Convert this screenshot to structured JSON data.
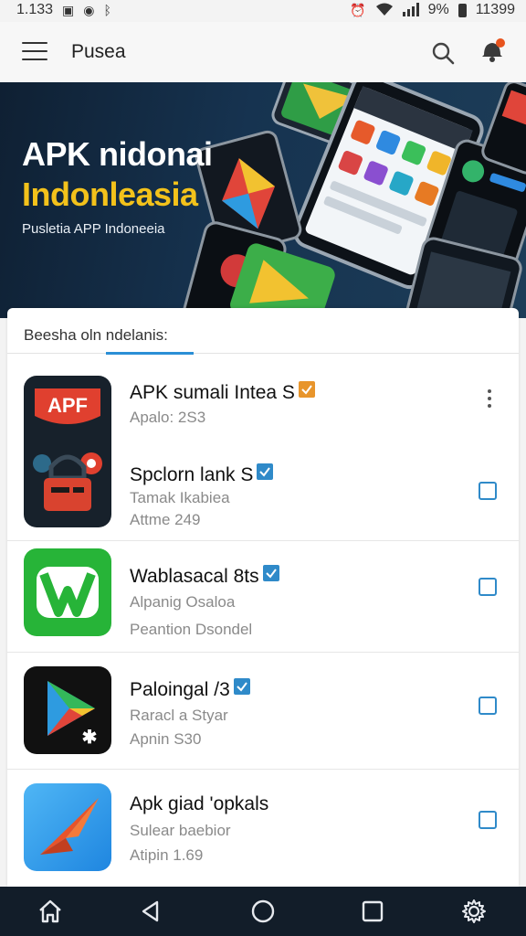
{
  "status_bar": {
    "time": "1.133",
    "battery_text": "9%",
    "clock_right": "11399",
    "icons": [
      "photo-icon",
      "messenger-icon",
      "bluetooth-icon",
      "alarm-icon",
      "wifi-icon",
      "signal-icon",
      "battery-icon"
    ]
  },
  "app_bar": {
    "title": "Pusea",
    "icons": [
      "menu-icon",
      "search-icon",
      "notification-bell-icon"
    ]
  },
  "banner": {
    "title_line1": "APK nidonai",
    "title_line2": "Indonleasia",
    "subtitle": "Pusletia APP Indoneeia",
    "colors": {
      "title1": "#ffffff",
      "title2": "#f3c21b",
      "background": "#163350"
    }
  },
  "list": {
    "header": "Beesha oln ndelanis:",
    "accent": "#2b8fd6",
    "items": [
      {
        "name": "APK sumali Intea S",
        "meta1": "Apalo: 2S3",
        "meta2": "",
        "icon": "apk-shield-icon",
        "control": "more-menu"
      },
      {
        "name": "Spclorn lank S",
        "meta1": "Tamak Ikabiea",
        "meta2": "Attme 249",
        "icon": "toolbox-icon",
        "control": "checkbox"
      },
      {
        "name": "Wablasacal 8ts",
        "meta1": "Alpanig Osaloa",
        "meta2": "Peantion Dsondel",
        "icon": "w-logo-icon",
        "control": "checkbox"
      },
      {
        "name": "Paloingal /3",
        "meta1": "Raracl a Styar",
        "meta2": "Apnin S30",
        "icon": "play-store-icon",
        "control": "checkbox"
      },
      {
        "name": "Apk giad 'opkals",
        "meta1": "Sulear baebior",
        "meta2": "Atipin 1.69",
        "icon": "paper-plane-icon",
        "control": "checkbox"
      }
    ]
  },
  "nav_bar": {
    "buttons": [
      "home-icon",
      "back-icon",
      "circle-home-icon",
      "recents-icon",
      "settings-gear-icon"
    ]
  }
}
